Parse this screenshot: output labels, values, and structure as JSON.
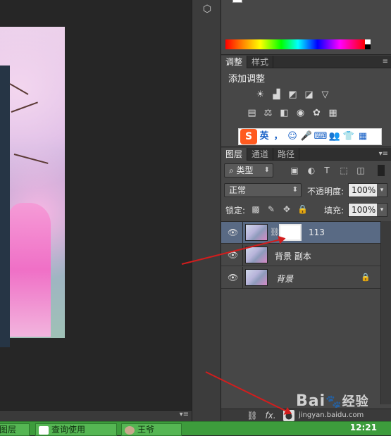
{
  "adjustments_panel": {
    "tabs": [
      "调整",
      "样式"
    ],
    "title": "添加调整",
    "row1_icons": [
      "brightness-icon",
      "levels-icon",
      "curves-icon",
      "exposure-icon",
      "gradient-triangle-icon"
    ],
    "row2_icons": [
      "vibrance-icon",
      "balance-scale-icon",
      "black-white-icon",
      "camera-filter-icon",
      "channel-mixer-icon",
      "color-lookup-icon"
    ]
  },
  "ime_toolbar": {
    "logo": "S",
    "mode": "英",
    "items": [
      "，",
      "☺",
      "🎤",
      "⌨",
      "👥",
      "👕",
      "▦"
    ]
  },
  "layers_panel": {
    "tabs": [
      "图层",
      "通道",
      "路径"
    ],
    "filter_label": "类型",
    "blend_mode": "正常",
    "opacity_label": "不透明度:",
    "opacity_value": "100%",
    "lock_label": "锁定:",
    "fill_label": "填充:",
    "fill_value": "100%",
    "layers": [
      {
        "name": "113",
        "selected": true,
        "has_mask": true
      },
      {
        "name": "背景 副本",
        "selected": false,
        "has_mask": false
      },
      {
        "name": "背景",
        "selected": false,
        "has_mask": false,
        "italic": true,
        "locked": true
      }
    ],
    "footer_icons": [
      "link-icon",
      "fx-icon",
      "add-mask-icon"
    ],
    "footer_fx_label": "fx."
  },
  "watermark": {
    "text": "Bai",
    "text2": "经验",
    "subtext": "jingyan.baidu.com"
  },
  "taskbar": {
    "items": [
      "图层",
      "查询使用",
      "王爷"
    ],
    "clock": "12:21"
  },
  "colors": {
    "panel_bg": "#474747",
    "canvas_bg": "#262626",
    "selection": "#596a84",
    "taskbar": "#3d9c3c",
    "annotation_red": "#d21d1d"
  }
}
